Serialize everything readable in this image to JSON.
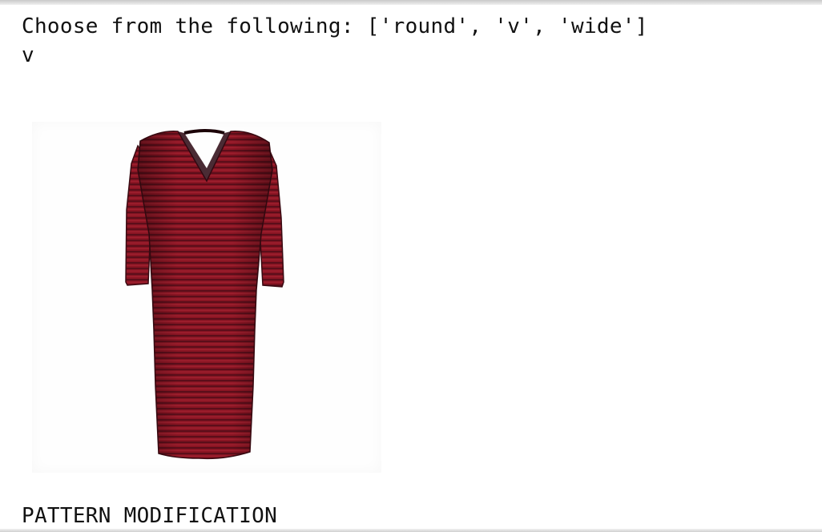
{
  "question": {
    "prompt": "Choose from the following: ['round', 'v', 'wide']",
    "answer": "v"
  },
  "image": {
    "subject": "dress-icon",
    "colors": {
      "primary": "#8a1523",
      "highlight": "#b52a3a",
      "shadow": "#3a0a12"
    }
  },
  "footer": {
    "label": "PATTERN MODIFICATION"
  }
}
